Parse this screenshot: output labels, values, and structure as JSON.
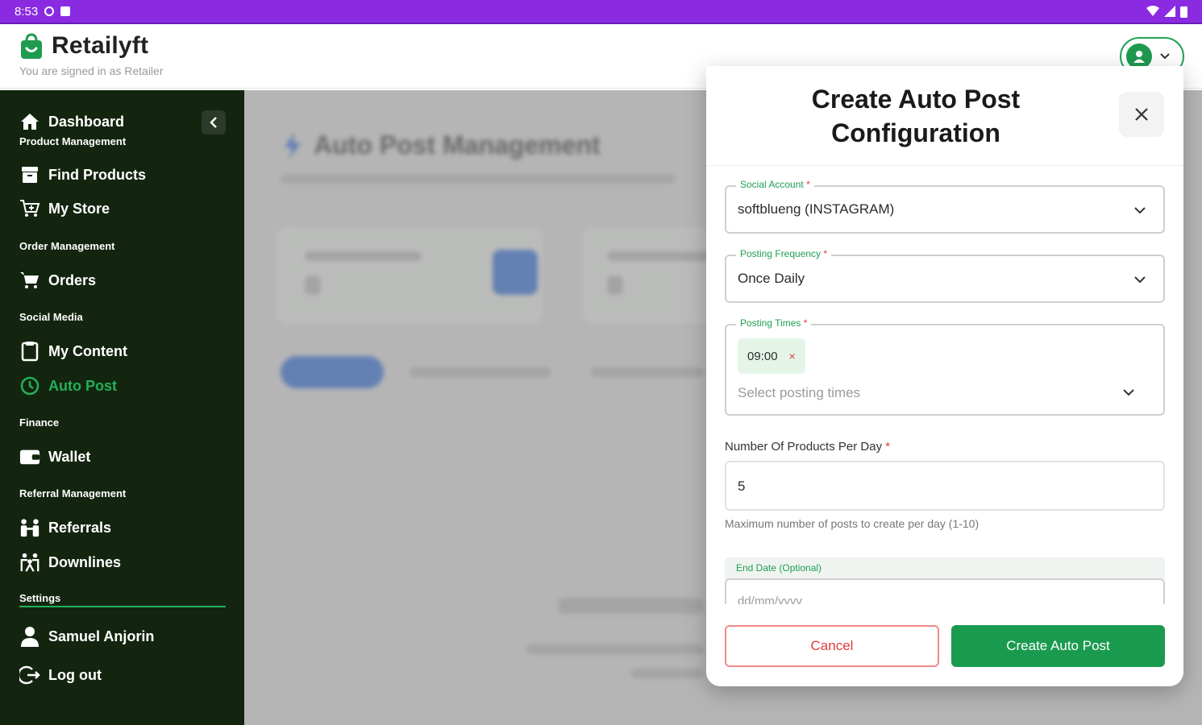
{
  "status_bar": {
    "time": "8:53"
  },
  "app": {
    "brand": "Retailyft",
    "signed_in_as": "You are signed in as Retailer",
    "brand_color": "#1e9b4f",
    "sidebar_bg": "#13250f"
  },
  "sidebar": {
    "dashboard": "Dashboard",
    "sections": {
      "product": "Product Management",
      "order": "Order Management",
      "social": "Social Media",
      "finance": "Finance",
      "referral": "Referral Management",
      "settings": "Settings"
    },
    "items": {
      "find_products": "Find Products",
      "my_store": "My Store",
      "orders": "Orders",
      "my_content": "My Content",
      "auto_post": "Auto Post",
      "wallet": "Wallet",
      "referrals": "Referrals",
      "downlines": "Downlines",
      "user_name": "Samuel Anjorin",
      "log_out": "Log out"
    }
  },
  "background_page": {
    "title": "Auto Post Management"
  },
  "modal": {
    "title": "Create Auto Post Configuration",
    "social_account": {
      "label": "Social Account",
      "required_mark": "*",
      "value": "softblueng (INSTAGRAM)"
    },
    "posting_frequency": {
      "label": "Posting Frequency",
      "required_mark": "*",
      "value": "Once Daily"
    },
    "posting_times": {
      "label": "Posting Times",
      "required_mark": "*",
      "chip": "09:00",
      "chip_remove": "×",
      "placeholder": "Select posting times"
    },
    "products_per_day": {
      "label": "Number Of Products Per Day",
      "required_mark": "*",
      "value": "5",
      "helper": "Maximum number of posts to create per day (1-10)"
    },
    "end_date": {
      "label": "End Date (Optional)",
      "placeholder": "dd/mm/yyyy"
    },
    "cancel_label": "Cancel",
    "create_label": "Create Auto Post"
  }
}
